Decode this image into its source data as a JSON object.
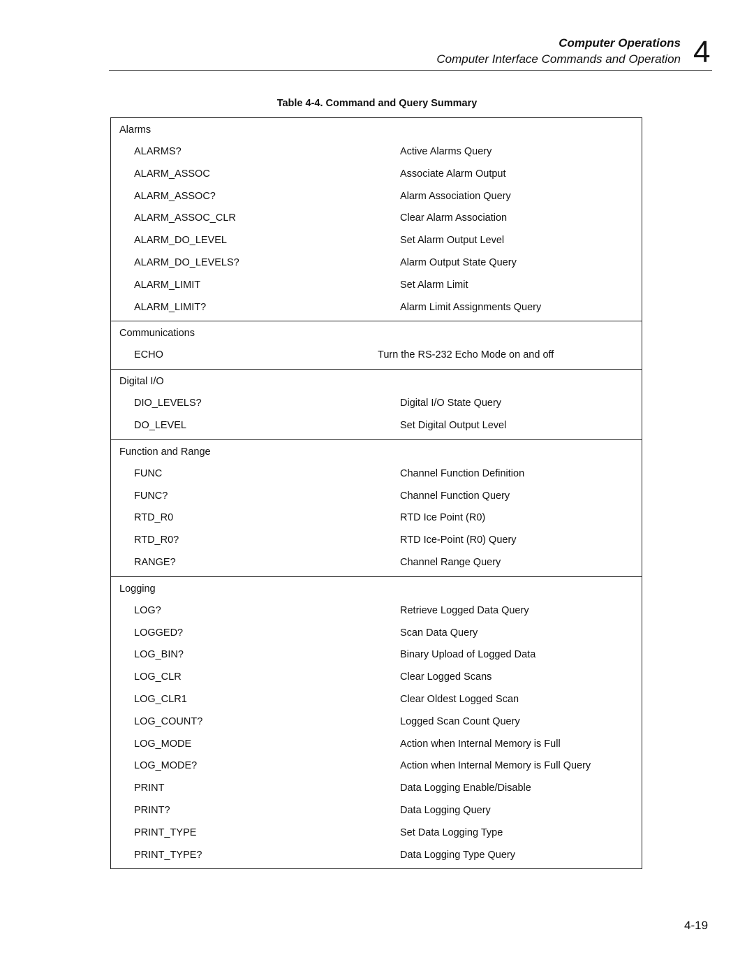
{
  "header": {
    "section_title": "Computer Operations",
    "subsection_title": "Computer Interface Commands and Operation",
    "chapter_number": "4"
  },
  "table": {
    "caption": "Table 4-4. Command and Query Summary",
    "groups": [
      {
        "title": "Alarms",
        "rows": [
          {
            "command": "ALARMS?",
            "description": "Active Alarms Query"
          },
          {
            "command": "ALARM_ASSOC",
            "description": "Associate Alarm Output"
          },
          {
            "command": "ALARM_ASSOC?",
            "description": "Alarm Association Query"
          },
          {
            "command": "ALARM_ASSOC_CLR",
            "description": "Clear Alarm Association"
          },
          {
            "command": "ALARM_DO_LEVEL",
            "description": "Set Alarm Output Level"
          },
          {
            "command": "ALARM_DO_LEVELS?",
            "description": "Alarm Output State Query"
          },
          {
            "command": "ALARM_LIMIT",
            "description": "Set Alarm Limit"
          },
          {
            "command": "ALARM_LIMIT?",
            "description": "Alarm Limit Assignments Query"
          }
        ]
      },
      {
        "title": "Communications",
        "rows": [
          {
            "command": "ECHO",
            "description": "Turn the RS-232 Echo Mode on and off"
          }
        ]
      },
      {
        "title": "Digital I/O",
        "rows": [
          {
            "command": "DIO_LEVELS?",
            "description": "Digital I/O State Query"
          },
          {
            "command": "DO_LEVEL",
            "description": "Set Digital Output Level"
          }
        ]
      },
      {
        "title": "Function and Range",
        "rows": [
          {
            "command": "FUNC",
            "description": "Channel Function Definition"
          },
          {
            "command": "FUNC?",
            "description": "Channel Function Query"
          },
          {
            "command": "RTD_R0",
            "description": "RTD Ice Point (R0)"
          },
          {
            "command": "RTD_R0?",
            "description": "RTD Ice-Point (R0) Query"
          },
          {
            "command": "RANGE?",
            "description": "Channel Range Query"
          }
        ]
      },
      {
        "title": "Logging",
        "rows": [
          {
            "command": "LOG?",
            "description": "Retrieve Logged Data Query"
          },
          {
            "command": "LOGGED?",
            "description": "Scan Data Query"
          },
          {
            "command": "LOG_BIN?",
            "description": "Binary Upload of Logged Data"
          },
          {
            "command": "LOG_CLR",
            "description": "Clear Logged Scans"
          },
          {
            "command": "LOG_CLR1",
            "description": "Clear Oldest Logged Scan"
          },
          {
            "command": "LOG_COUNT?",
            "description": "Logged Scan Count Query"
          },
          {
            "command": "LOG_MODE",
            "description": "Action when Internal Memory is Full"
          },
          {
            "command": "LOG_MODE?",
            "description": "Action when Internal Memory is Full Query"
          },
          {
            "command": "PRINT",
            "description": "Data Logging Enable/Disable"
          },
          {
            "command": "PRINT?",
            "description": "Data Logging Query"
          },
          {
            "command": "PRINT_TYPE",
            "description": "Set Data Logging Type"
          },
          {
            "command": "PRINT_TYPE?",
            "description": "Data Logging Type Query"
          }
        ]
      }
    ]
  },
  "footer": {
    "page_number": "4-19"
  }
}
